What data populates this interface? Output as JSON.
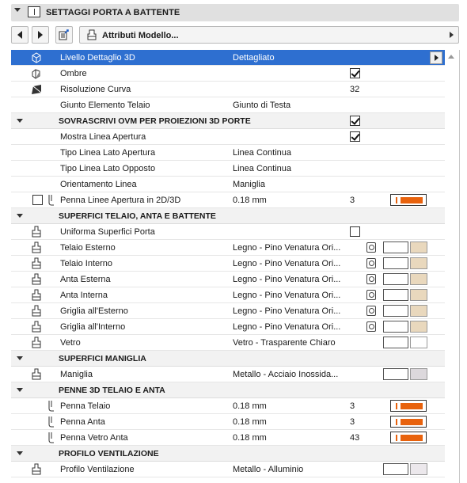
{
  "header": {
    "title": "SETTAGGI PORTA A BATTENTE"
  },
  "toolbar": {
    "attributes_label": "Attributi Modello..."
  },
  "rows": [
    {
      "name": "Livello Dettaglio 3D",
      "value": "Dettagliato",
      "selected": true
    },
    {
      "name": "Ombre",
      "checked": true
    },
    {
      "name": "Risoluzione Curva",
      "num": "32"
    },
    {
      "name": "Giunto Elemento Telaio",
      "value": "Giunto di Testa"
    },
    {
      "section": "SOVRASCRIVI OVM PER PROIEZIONI 3D PORTE",
      "checked": true
    },
    {
      "name": "Mostra Linea Apertura",
      "checked": true
    },
    {
      "name": "Tipo Linea Lato Apertura",
      "value": "Linea Continua"
    },
    {
      "name": "Tipo Linea Lato Opposto",
      "value": "Linea Continua"
    },
    {
      "name": "Orientamento Linea",
      "value": "Maniglia"
    },
    {
      "name": "Penna Linee Apertura in 2D/3D",
      "value": "0.18 mm",
      "num": "3"
    },
    {
      "section": "SUPERFICI TELAIO, ANTA E BATTENTE"
    },
    {
      "name": "Uniforma Superfici Porta",
      "checked": false
    },
    {
      "name": "Telaio Esterno",
      "value": "Legno - Pino Venatura Ori..."
    },
    {
      "name": "Telaio Interno",
      "value": "Legno - Pino Venatura Ori..."
    },
    {
      "name": "Anta Esterna",
      "value": "Legno - Pino Venatura Ori..."
    },
    {
      "name": "Anta Interna",
      "value": "Legno - Pino Venatura Ori..."
    },
    {
      "name": "Griglia all'Esterno",
      "value": "Legno - Pino Venatura Ori..."
    },
    {
      "name": "Griglia all'Interno",
      "value": "Legno - Pino Venatura Ori..."
    },
    {
      "name": "Vetro",
      "value": "Vetro - Trasparente Chiaro"
    },
    {
      "section": "SUPERFICI MANIGLIA"
    },
    {
      "name": "Maniglia",
      "value": "Metallo - Acciaio Inossida..."
    },
    {
      "section": "PENNE 3D TELAIO E ANTA"
    },
    {
      "name": "Penna Telaio",
      "value": "0.18 mm",
      "num": "3"
    },
    {
      "name": "Penna Anta",
      "value": "0.18 mm",
      "num": "3"
    },
    {
      "name": "Penna Vetro Anta",
      "value": "0.18 mm",
      "num": "43"
    },
    {
      "section": "PROFILO VENTILAZIONE"
    },
    {
      "name": "Profilo Ventilazione",
      "value": "Metallo - Alluminio"
    }
  ],
  "colors": {
    "selected": "#2e6fd0",
    "pen": "#e8620d",
    "wood": "#e9d8bd",
    "metal": "#dcd8dc"
  },
  "icons": [
    "cube-icon",
    "shadow-icon",
    "curve-resolution-icon",
    "surface-brush-icon",
    "pen-icon",
    "material-picker-icon"
  ]
}
